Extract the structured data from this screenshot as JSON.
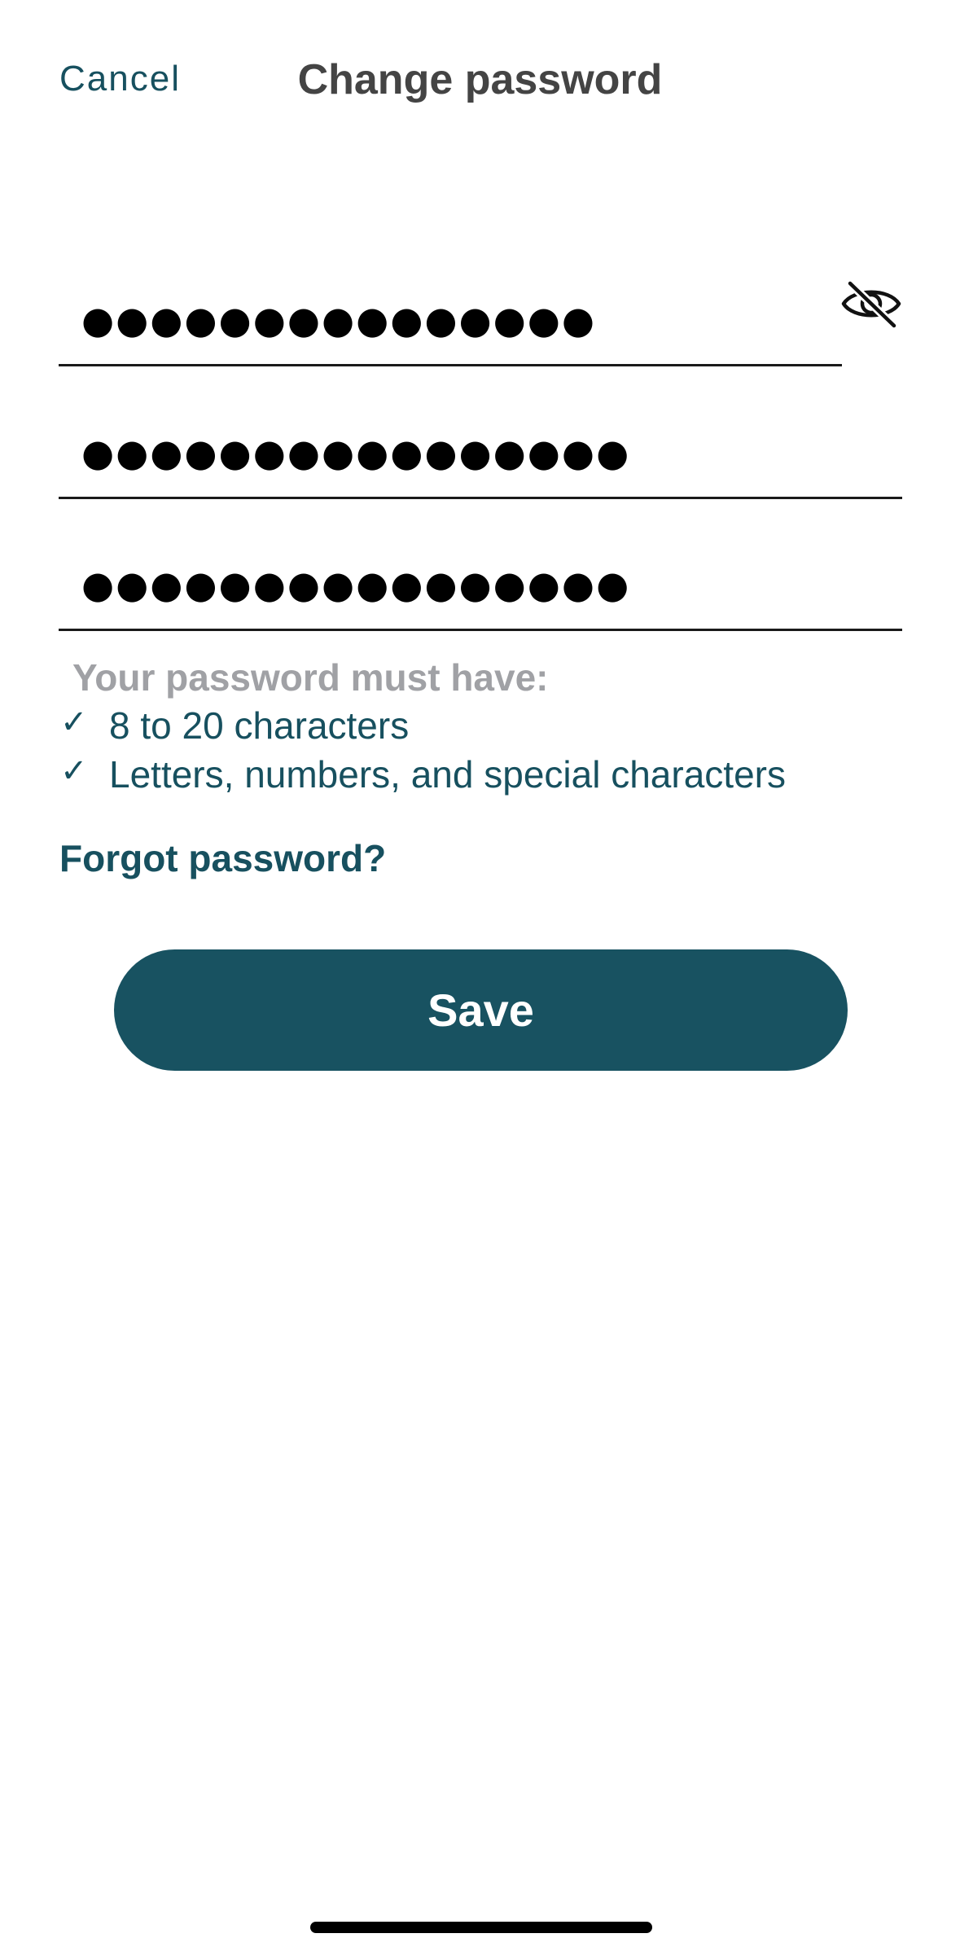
{
  "nav": {
    "cancel_label": "Cancel",
    "title": "Change password"
  },
  "fields": {
    "current_password_value": "●●●●●●●●●●●●●●●",
    "new_password_value": "●●●●●●●●●●●●●●●●",
    "confirm_password_value": "●●●●●●●●●●●●●●●●",
    "visibility_icon": "eye-slash-icon"
  },
  "requirements": {
    "heading": "Your password must have:",
    "check_glyph": "✓",
    "items": [
      "8 to 20 characters",
      "Letters, numbers, and special characters"
    ]
  },
  "links": {
    "forgot_password": "Forgot password?"
  },
  "actions": {
    "save_label": "Save"
  },
  "colors": {
    "accent": "#185261",
    "title_text": "#444444",
    "muted_text": "#a0a1a5"
  }
}
